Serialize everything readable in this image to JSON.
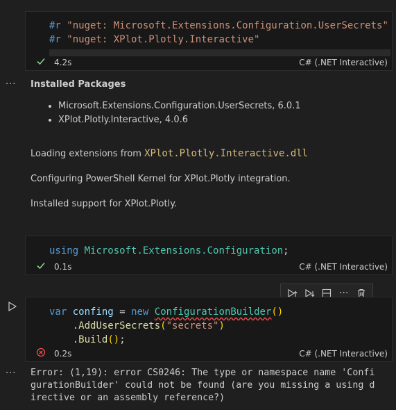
{
  "cell1": {
    "line1": {
      "directive": "#r",
      "arg": "\"nuget: Microsoft.Extensions.Configuration.UserSecrets\""
    },
    "line2": {
      "directive": "#r",
      "arg": "\"nuget: XPlot.Plotly.Interactive\""
    },
    "time": "4.2s",
    "language": "C# (.NET Interactive)"
  },
  "output1": {
    "heading": "Installed Packages",
    "packages": [
      "Microsoft.Extensions.Configuration.UserSecrets, 6.0.1",
      "XPlot.Plotly.Interactive, 4.0.6"
    ],
    "loading_prefix": "Loading extensions from",
    "loading_file": "XPlot.Plotly.Interactive.dll",
    "configuring": "Configuring PowerShell Kernel for XPlot.Plotly integration.",
    "installed_support": "Installed support for XPlot.Plotly."
  },
  "cell2": {
    "keyword": "using",
    "namespace": "Microsoft.Extensions.Configuration",
    "semicolon": ";",
    "time": "0.1s",
    "language": "C# (.NET Interactive)"
  },
  "cell3": {
    "kw_var": "var",
    "ident": "confing",
    "eq": "=",
    "kw_new": "new",
    "type": "ConfigurationBuilder",
    "paren_open": "(",
    "paren_close": ")",
    "method1": "AddUserSecrets",
    "arg": "\"secrets\"",
    "method2": "Build",
    "end": ";",
    "time": "0.2s",
    "language": "C# (.NET Interactive)"
  },
  "error": {
    "lines": [
      "Error: (1,19): error CS0246: The type or namespace name 'Confi",
      "gurationBuilder' could not be found (are you missing a using d",
      "irective or an assembly reference?)"
    ]
  },
  "colors": {
    "background": "#1f1f1f",
    "success": "#89d185",
    "error": "#f14c4c"
  }
}
